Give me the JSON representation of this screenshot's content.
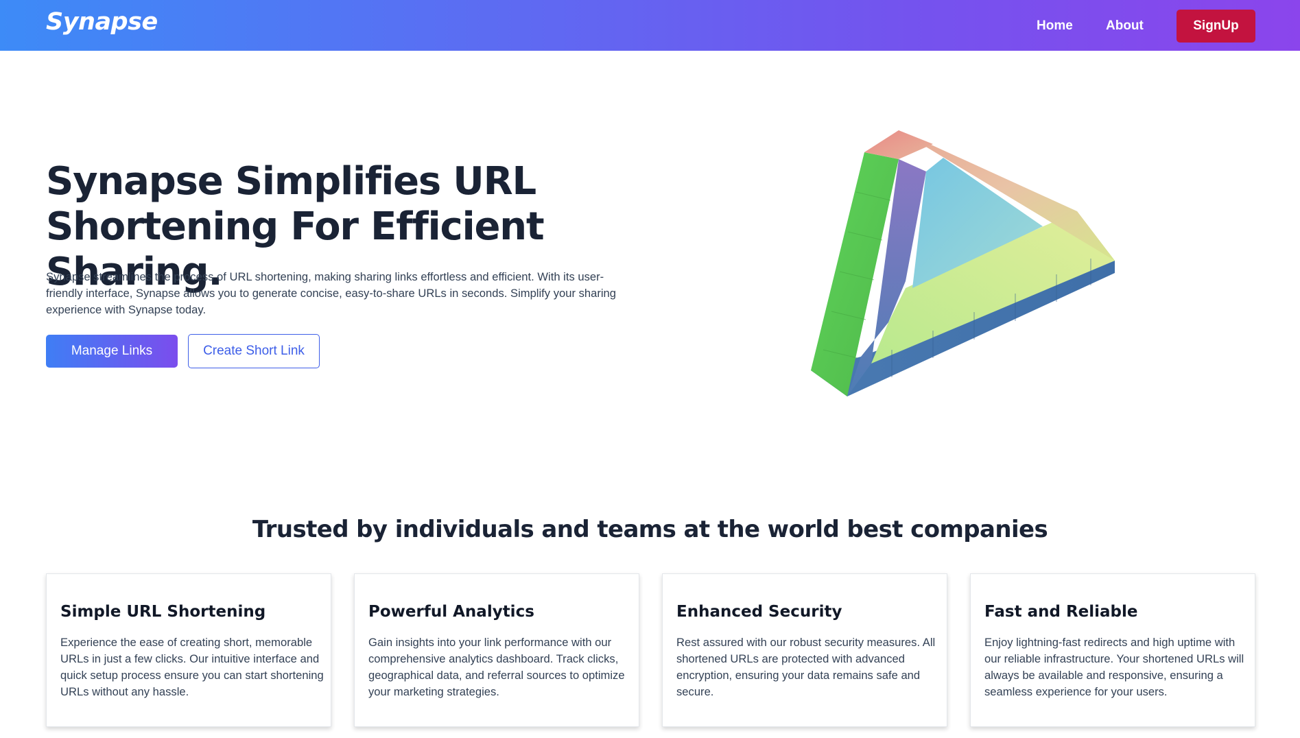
{
  "nav": {
    "logo": "Synapse",
    "links": [
      "Home",
      "About"
    ],
    "signup_label": "SignUp"
  },
  "hero": {
    "title_line1": "Synapse Simplifies URL",
    "title_line2": "Shortening For Efficient Sharing.",
    "description": "Synapse streamlines the process of URL shortening, making sharing links effortless and efficient. With its user-friendly interface, Synapse allows you to generate concise, easy-to-share URLs in seconds. Simplify your sharing experience with Synapse today.",
    "primary_button": "Manage Links",
    "secondary_button": "Create Short Link",
    "illustration": "impossible-triangle-illustration"
  },
  "trusted": {
    "heading": "Trusted by individuals and teams at the world best companies"
  },
  "features": [
    {
      "title": "Simple URL Shortening",
      "text": "Experience the ease of creating short, memorable URLs in just a few clicks. Our intuitive interface and quick setup process ensure you can start shortening URLs without any hassle."
    },
    {
      "title": "Powerful Analytics",
      "text": "Gain insights into your link performance with our comprehensive analytics dashboard. Track clicks, geographical data, and referral sources to optimize your marketing strategies."
    },
    {
      "title": "Enhanced Security",
      "text": "Rest assured with our robust security measures. All shortened URLs are protected with advanced encryption, ensuring your data remains safe and secure."
    },
    {
      "title": "Fast and Reliable",
      "text": "Enjoy lightning-fast redirects and high uptime with our reliable infrastructure. Your shortened URLs will always be available and responsive, ensuring a seamless experience for your users."
    }
  ],
  "colors": {
    "nav_gradient_start": "#3d8bf7",
    "nav_gradient_end": "#8b45ec",
    "signup_bg": "#c3133f",
    "heading_text": "#1a2335",
    "outline_accent": "#3d5ee8"
  }
}
